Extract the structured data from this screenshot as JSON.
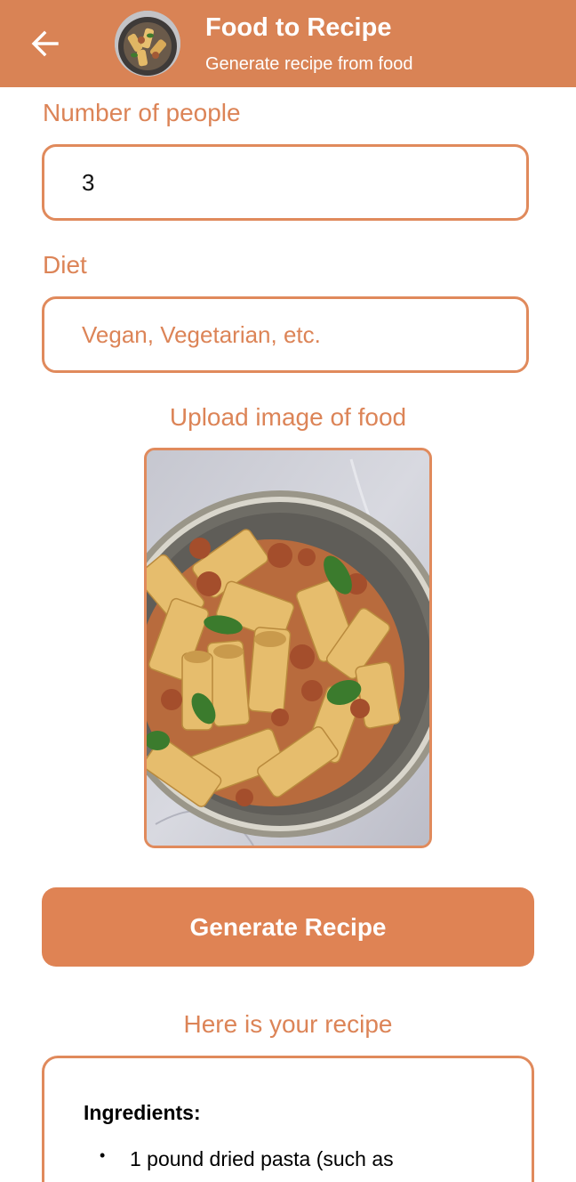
{
  "app_bar": {
    "title": "Food to Recipe",
    "subtitle": "Generate recipe from food",
    "back_icon": "arrow-left-icon",
    "background_color": "#d98355"
  },
  "form": {
    "people_label": "Number of people",
    "people_value": "3",
    "diet_label": "Diet",
    "diet_value": "",
    "diet_placeholder": "Vegan, Vegetarian, etc.",
    "upload_label": "Upload image of food",
    "generate_button": "Generate Recipe"
  },
  "result": {
    "label": "Here is your recipe",
    "section_heading": "Ingredients:",
    "items": [
      "1 pound dried pasta (such as"
    ]
  },
  "colors": {
    "accent": "#df8354",
    "label_text": "#dc8457",
    "border": "#e08a5c"
  }
}
